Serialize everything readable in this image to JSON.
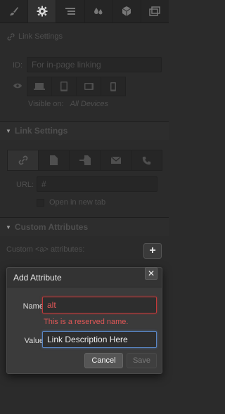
{
  "tabs": [
    {
      "icon": "brush-icon",
      "active": false
    },
    {
      "icon": "gear-icon",
      "active": true
    },
    {
      "icon": "lines-icon",
      "active": false
    },
    {
      "icon": "drops-icon",
      "active": false
    },
    {
      "icon": "cube-icon",
      "active": false
    },
    {
      "icon": "images-icon",
      "active": false
    }
  ],
  "link_settings_top": {
    "label": "Link Settings",
    "id_label": "ID:",
    "id_placeholder": "For in-page linking",
    "visible_on_label": "Visible on:",
    "visible_on_value": "All Devices"
  },
  "link_settings": {
    "header": "Link Settings",
    "url_label": "URL:",
    "url_value": "#",
    "new_tab_label": "Open in new tab"
  },
  "custom_attributes": {
    "header": "Custom Attributes",
    "attributes_label": "Custom <a> attributes:",
    "add_symbol": "+"
  },
  "modal": {
    "title": "Add Attribute",
    "close_symbol": "✕",
    "name_label": "Name:",
    "name_value": "alt",
    "error_text": "This is a reserved name.",
    "value_label": "Value:",
    "value_value": "Link Description Here",
    "cancel_label": "Cancel",
    "save_label": "Save"
  },
  "colors": {
    "panel_bg": "#2b2b2b",
    "error": "#e05757",
    "focus": "#5a86c4"
  }
}
